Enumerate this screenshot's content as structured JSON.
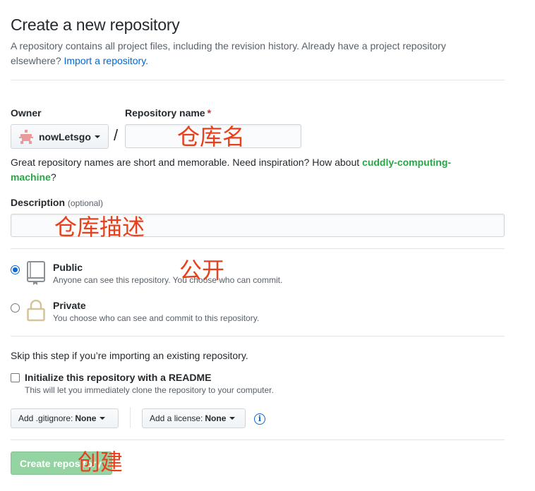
{
  "header": {
    "title": "Create a new repository",
    "subtitle_text": "A repository contains all project files, including the revision history. Already have a project repository elsewhere?",
    "import_link": "Import a repository."
  },
  "owner": {
    "label": "Owner",
    "name": "nowLetsgo"
  },
  "repo_name": {
    "label": "Repository name",
    "required_mark": "*",
    "value": "",
    "placeholder": "",
    "separator": "/"
  },
  "hint": {
    "text": "Great repository names are short and memorable. Need inspiration? How about",
    "suggestion": "cuddly-computing-machine",
    "suffix": "?"
  },
  "description": {
    "label": "Description",
    "optional": "(optional)",
    "value": ""
  },
  "visibility": {
    "public": {
      "title": "Public",
      "desc": "Anyone can see this repository. You choose who can commit.",
      "checked": true
    },
    "private": {
      "title": "Private",
      "desc": "You choose who can see and commit to this repository.",
      "checked": false
    }
  },
  "init": {
    "skip_text": "Skip this step if you’re importing an existing repository.",
    "readme_title": "Initialize this repository with a README",
    "readme_desc": "This will let you immediately clone the repository to your computer.",
    "checked": false
  },
  "options": {
    "gitignore_label": "Add .gitignore:",
    "gitignore_value": "None",
    "license_label": "Add a license:",
    "license_value": "None",
    "info_symbol": "i"
  },
  "submit": {
    "label": "Create repository"
  },
  "annotations": {
    "repo_name": "仓库名",
    "description": "仓库描述",
    "public": "公开",
    "create": "创建"
  },
  "colors": {
    "annotation": "#e8401c",
    "link": "#0366d6",
    "suggestion": "#28a745",
    "create_button_disabled": "#94d3a2",
    "radio_checked": "#0a6ad6"
  }
}
